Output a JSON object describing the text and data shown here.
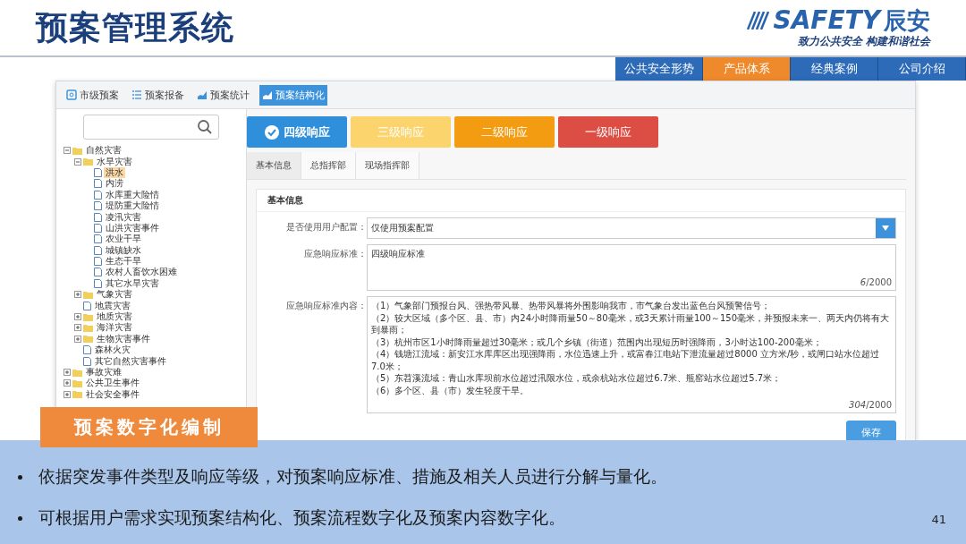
{
  "slide": {
    "title": "预案管理系统",
    "logo": {
      "wordmark": "SAFETY",
      "name": "辰安",
      "slogan": "致力公共安全 构建和谐社会"
    },
    "nav": [
      {
        "label": "公共安全形势",
        "selected": false
      },
      {
        "label": "产品体系",
        "selected": true
      },
      {
        "label": "经典案例",
        "selected": false
      },
      {
        "label": "公司介绍",
        "selected": false
      }
    ]
  },
  "app": {
    "toolbar_tabs": [
      {
        "label": "市级预案",
        "selected": false,
        "kind": "doc"
      },
      {
        "label": "预案报备",
        "selected": false,
        "kind": "list"
      },
      {
        "label": "预案统计",
        "selected": false,
        "kind": "chart"
      },
      {
        "label": "预案结构化",
        "selected": true,
        "kind": "chart"
      }
    ],
    "tree": [
      {
        "label": "自然灾害",
        "kind": "folder",
        "expanded": true,
        "selected": false,
        "children": [
          {
            "label": "水旱灾害",
            "kind": "folder",
            "expanded": true,
            "selected": false,
            "children": [
              {
                "label": "洪水",
                "kind": "file",
                "selected": true
              },
              {
                "label": "内涝",
                "kind": "file",
                "selected": false
              },
              {
                "label": "水库重大险情",
                "kind": "file",
                "selected": false
              },
              {
                "label": "堤防重大险情",
                "kind": "file",
                "selected": false
              },
              {
                "label": "凌汛灾害",
                "kind": "file",
                "selected": false
              },
              {
                "label": "山洪灾害事件",
                "kind": "file",
                "selected": false
              },
              {
                "label": "农业干旱",
                "kind": "file",
                "selected": false
              },
              {
                "label": "城镇缺水",
                "kind": "file",
                "selected": false
              },
              {
                "label": "生态干旱",
                "kind": "file",
                "selected": false
              },
              {
                "label": "农村人畜饮水困难",
                "kind": "file",
                "selected": false
              },
              {
                "label": "其它水旱灾害",
                "kind": "file",
                "selected": false
              }
            ]
          },
          {
            "label": "气象灾害",
            "kind": "folder",
            "expanded": false,
            "selected": false
          },
          {
            "label": "地震灾害",
            "kind": "file",
            "selected": false
          },
          {
            "label": "地质灾害",
            "kind": "folder",
            "expanded": false,
            "selected": false
          },
          {
            "label": "海洋灾害",
            "kind": "folder",
            "expanded": false,
            "selected": false
          },
          {
            "label": "生物灾害事件",
            "kind": "folder",
            "expanded": false,
            "selected": false
          },
          {
            "label": "森林火灾",
            "kind": "file",
            "selected": false
          },
          {
            "label": "其它自然灾害事件",
            "kind": "file",
            "selected": false
          }
        ]
      },
      {
        "label": "事故灾难",
        "kind": "folder",
        "expanded": false,
        "selected": false
      },
      {
        "label": "公共卫生事件",
        "kind": "folder",
        "expanded": false,
        "selected": false
      },
      {
        "label": "社会安全事件",
        "kind": "folder",
        "expanded": false,
        "selected": false
      }
    ],
    "levels": [
      {
        "label": "四级响应",
        "selected": true,
        "color": "#2f8fdb"
      },
      {
        "label": "三级响应",
        "selected": false,
        "color": "#fcd46e"
      },
      {
        "label": "二级响应",
        "selected": false,
        "color": "#f39c12"
      },
      {
        "label": "一级响应",
        "selected": false,
        "color": "#dc4d44"
      }
    ],
    "subtabs": [
      {
        "label": "基本信息",
        "selected": true
      },
      {
        "label": "总指挥部",
        "selected": false
      },
      {
        "label": "现场指挥部",
        "selected": false
      }
    ],
    "form": {
      "section_title": "基本信息",
      "fields": [
        {
          "kind": "select",
          "label": "是否使用用户配置：",
          "value": "仅使用预案配置"
        },
        {
          "kind": "textarea",
          "label": "应急响应标准：",
          "lines": [
            "四级响应标准"
          ],
          "count": "*6*/2000"
        },
        {
          "kind": "textarea",
          "label": "应急响应标准内容：",
          "lines": [
            "（1）气象部门预报台风、强热带风暴、热带风暴将外围影响我市，市气象台发出蓝色台风预警信号；",
            "（2）较大区域（多个区、县、市）内24小时降雨量50～80毫米，或3天累计雨量100～150毫米，并预报未来一、两天内仍将有大到暴雨；",
            "（3）杭州市区1小时降雨量超过30毫米；或几个乡镇（街道）范围内出现短历时强降雨，3小时达100-200毫米；",
            "（4）钱塘江流域：新安江水库库区出现强降雨，水位迅速上升，或富春江电站下泄流量超过8000 立方米/秒，或闸口站水位超过7.0米；",
            "（5）东苕溪流域：青山水库坝前水位超过汛限水位，或余杭站水位超过6.7米、瓶窑站水位超过5.7米；",
            "（6）多个区、县（市）发生轻度干旱。"
          ],
          "count": "*304*/2000"
        }
      ],
      "save_button": "保存"
    }
  },
  "callout": "预案数字化编制",
  "bullets": [
    "依据突发事件类型及响应等级，对预案响应标准、措施及相关人员进行分解与量化。",
    "可根据用户需求实现预案结构化、预案流程数字化及预案内容数字化。"
  ],
  "page_number": "41"
}
